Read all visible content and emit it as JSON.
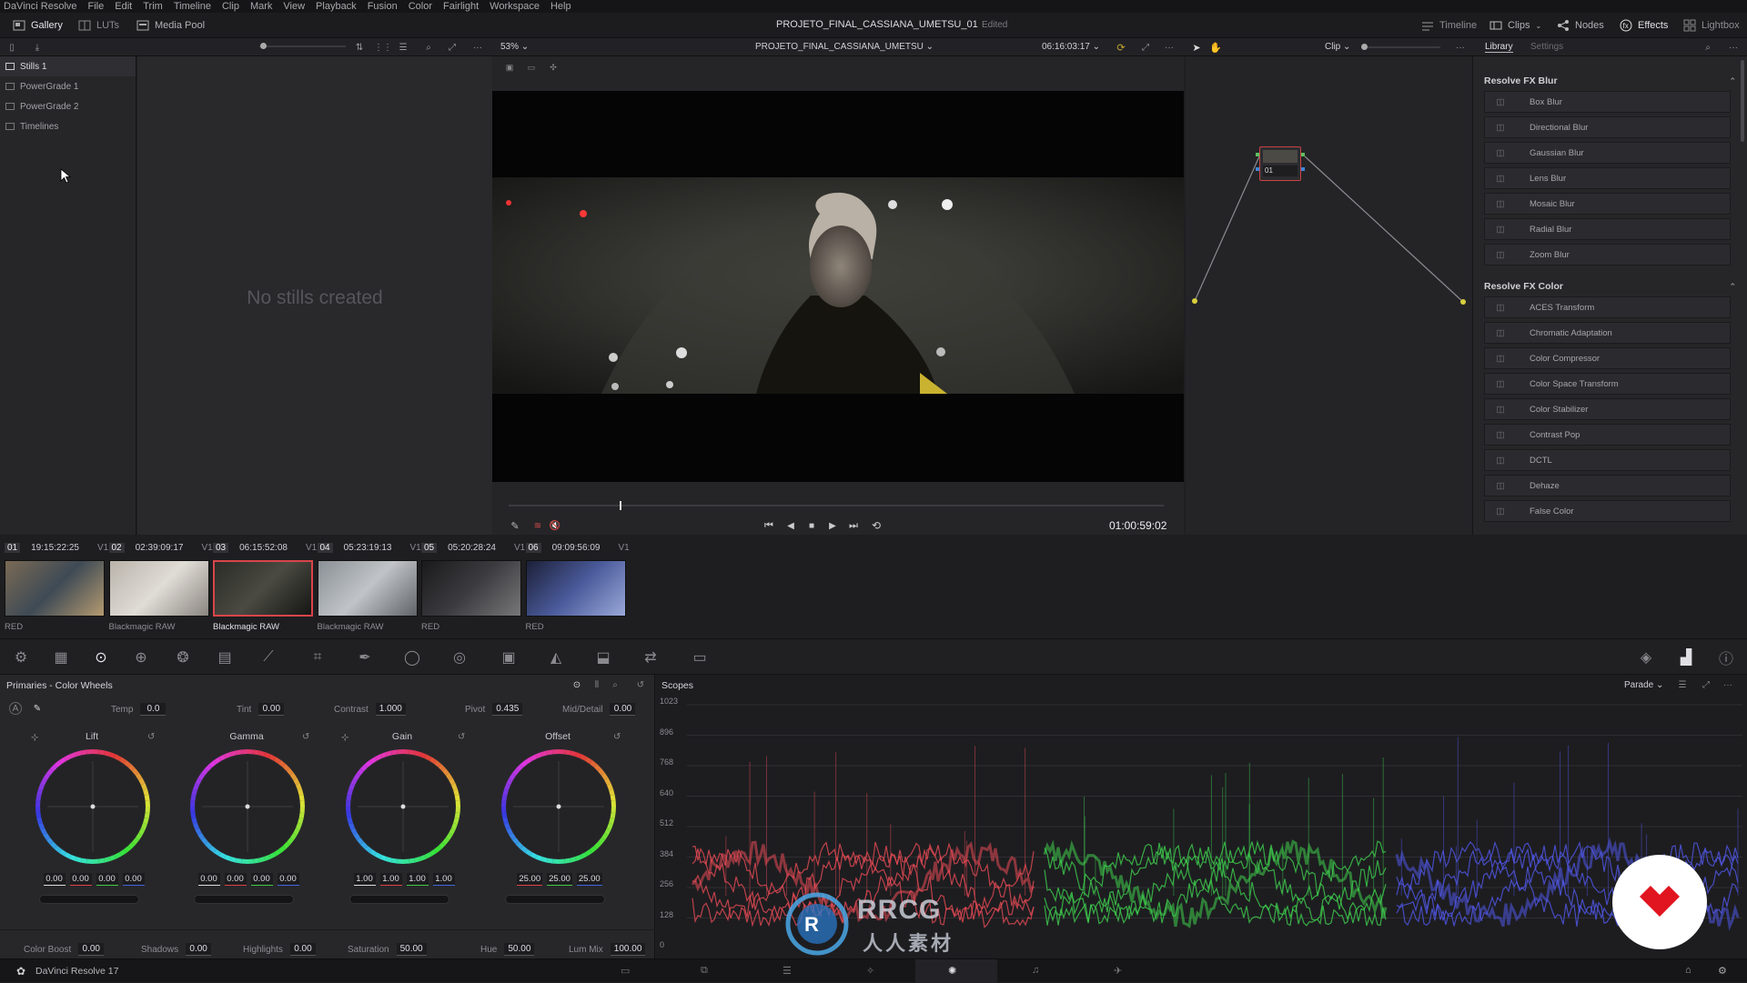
{
  "menu": [
    "DaVinci Resolve",
    "File",
    "Edit",
    "Trim",
    "Timeline",
    "Clip",
    "Mark",
    "View",
    "Playback",
    "Fusion",
    "Color",
    "Fairlight",
    "Workspace",
    "Help"
  ],
  "topbar": {
    "gallery": "Gallery",
    "luts": "LUTs",
    "media_pool": "Media Pool",
    "project_title": "PROJETO_FINAL_CASSIANA_UMETSU_01",
    "edited": "Edited",
    "timeline": "Timeline",
    "clips": "Clips",
    "nodes": "Nodes",
    "effects": "Effects",
    "lightbox": "Lightbox"
  },
  "viewer_bar": {
    "zoom": "53%",
    "timeline_name": "PROJETO_FINAL_CASSIANA_UMETSU",
    "timecode": "06:16:03:17",
    "clip_mode": "Clip"
  },
  "library_tabs": {
    "library": "Library",
    "settings": "Settings"
  },
  "stills": {
    "items": [
      "Stills 1",
      "PowerGrade 1",
      "PowerGrade 2",
      "Timelines"
    ],
    "empty": "No stills created"
  },
  "viewer": {
    "playhead_fraction": 0.17,
    "current_tc": "01:00:59:02"
  },
  "node": {
    "label": "01"
  },
  "library": {
    "blur_head": "Resolve FX Blur",
    "blur_items": [
      "Box Blur",
      "Directional Blur",
      "Gaussian Blur",
      "Lens Blur",
      "Mosaic Blur",
      "Radial Blur",
      "Zoom Blur"
    ],
    "color_head": "Resolve FX Color",
    "color_items": [
      "ACES Transform",
      "Chromatic Adaptation",
      "Color Compressor",
      "Color Space Transform",
      "Color Stabilizer",
      "Contrast Pop",
      "DCTL",
      "Dehaze",
      "False Color"
    ]
  },
  "clips": [
    {
      "num": "01",
      "tc": "19:15:22:25",
      "track": "V1",
      "codec": "RED"
    },
    {
      "num": "02",
      "tc": "02:39:09:17",
      "track": "V1",
      "codec": "Blackmagic RAW"
    },
    {
      "num": "03",
      "tc": "06:15:52:08",
      "track": "V1",
      "codec": "Blackmagic RAW"
    },
    {
      "num": "04",
      "tc": "05:23:19:13",
      "track": "V1",
      "codec": "Blackmagic RAW"
    },
    {
      "num": "05",
      "tc": "05:20:28:24",
      "track": "V1",
      "codec": "RED"
    },
    {
      "num": "06",
      "tc": "09:09:56:09",
      "track": "V1",
      "codec": "RED"
    }
  ],
  "primaries": {
    "title": "Primaries - Color Wheels",
    "temp_label": "Temp",
    "temp": "0.0",
    "tint_label": "Tint",
    "tint": "0.00",
    "contrast_label": "Contrast",
    "contrast": "1.000",
    "pivot_label": "Pivot",
    "pivot": "0.435",
    "middetail_label": "Mid/Detail",
    "middetail": "0.00",
    "wheels": [
      {
        "name": "Lift",
        "values": [
          "0.00",
          "0.00",
          "0.00",
          "0.00"
        ]
      },
      {
        "name": "Gamma",
        "values": [
          "0.00",
          "0.00",
          "0.00",
          "0.00"
        ]
      },
      {
        "name": "Gain",
        "values": [
          "1.00",
          "1.00",
          "1.00",
          "1.00"
        ]
      },
      {
        "name": "Offset",
        "values": [
          "25.00",
          "25.00",
          "25.00"
        ]
      }
    ],
    "colorboost_label": "Color Boost",
    "colorboost": "0.00",
    "shadows_label": "Shadows",
    "shadows": "0.00",
    "highlights_label": "Highlights",
    "highlights": "0.00",
    "saturation_label": "Saturation",
    "saturation": "50.00",
    "hue_label": "Hue",
    "hue": "50.00",
    "lummix_label": "Lum Mix",
    "lummix": "100.00"
  },
  "scopes": {
    "title": "Scopes",
    "mode": "Parade",
    "ticks": [
      "1023",
      "896",
      "768",
      "640",
      "512",
      "384",
      "256",
      "128",
      "0"
    ]
  },
  "status": {
    "app": "DaVinci Resolve 17"
  },
  "watermark": {
    "text1": "RRCG",
    "text2": "人人素材"
  },
  "colors": {
    "accent_red": "#d9454a",
    "scope_red": "#e84b55",
    "scope_green": "#3fcf4d",
    "scope_blue": "#5158e8"
  }
}
